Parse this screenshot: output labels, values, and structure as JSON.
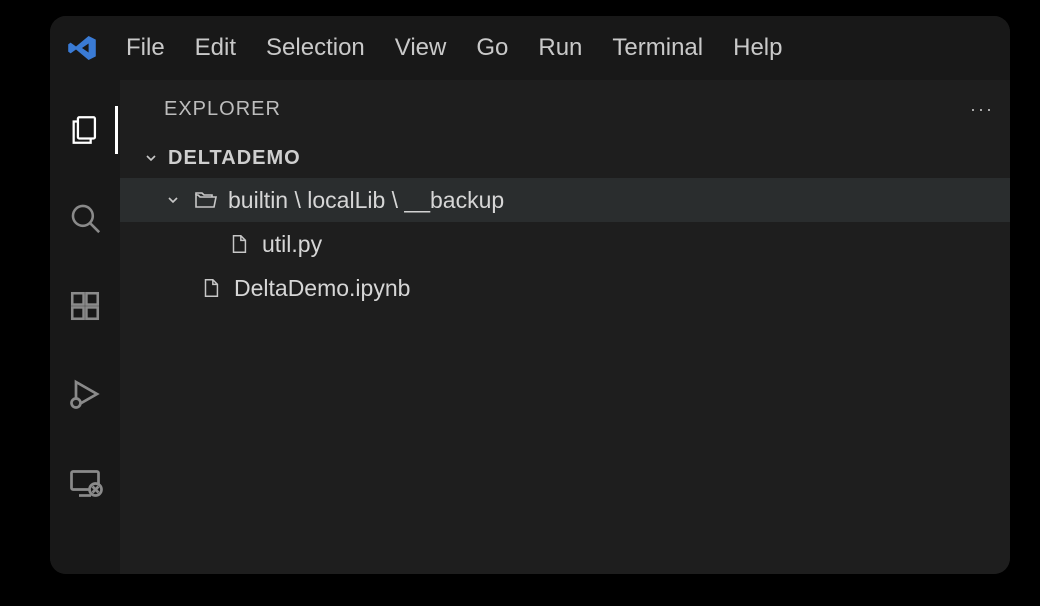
{
  "menubar": {
    "items": [
      "File",
      "Edit",
      "Selection",
      "View",
      "Go",
      "Run",
      "Terminal",
      "Help"
    ]
  },
  "activitybar": {
    "items": [
      {
        "name": "explorer",
        "active": true
      },
      {
        "name": "search",
        "active": false
      },
      {
        "name": "extensions",
        "active": false
      },
      {
        "name": "run-debug",
        "active": false
      },
      {
        "name": "remote",
        "active": false
      }
    ]
  },
  "sidebar": {
    "title": "EXPLORER",
    "more": "···",
    "section": "DELTADEMO",
    "tree": {
      "folder_path": "builtin \\ localLib \\ __backup",
      "files": [
        {
          "name": "util.py",
          "depth": 2
        },
        {
          "name": "DeltaDemo.ipynb",
          "depth": 1
        }
      ]
    }
  }
}
